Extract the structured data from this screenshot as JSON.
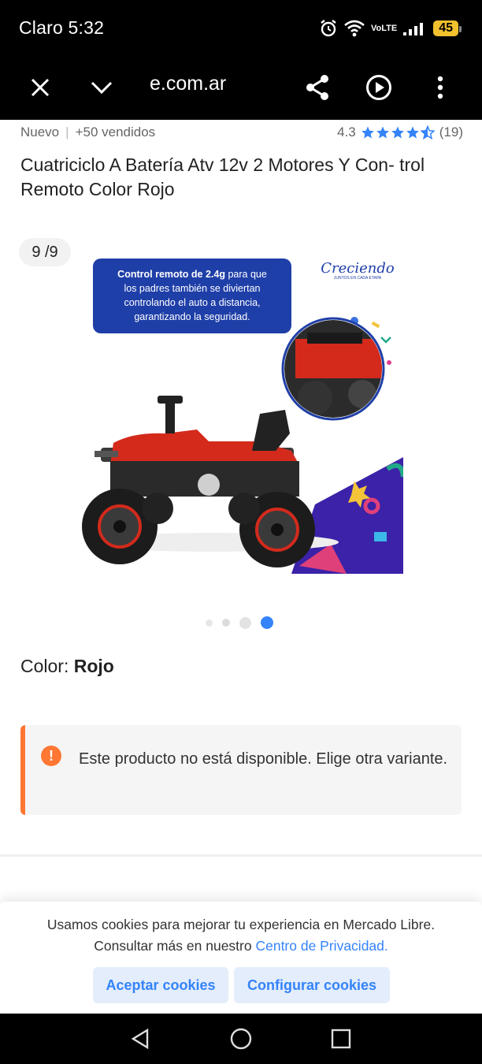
{
  "status_bar": {
    "carrier_time": "Claro 5:32",
    "network_top": "Vo",
    "network_bottom": "LTE",
    "battery": "45"
  },
  "browser": {
    "url": "e.com.ar",
    "icons": [
      "close-icon",
      "chevron-down-icon",
      "share-icon",
      "play-icon",
      "more-vert-icon"
    ]
  },
  "product": {
    "condition": "Nuevo",
    "separator": "|",
    "sold": "+50 vendidos",
    "rating_value": "4.3",
    "rating_count": "(19)",
    "rating_stars": 4.3,
    "title": "Cuatriciclo A Batería Atv 12v 2 Motores Y Con- trol Remoto Color Rojo"
  },
  "gallery": {
    "counter": "9 /9",
    "callout_bold": "Control remoto de 2.4g",
    "callout_rest": " para que los padres también se diviertan controlando el auto a distancia, garantizando la seguridad.",
    "brand": "Creciendo",
    "brand_tagline": "JUNTOS EN CADA ETAPA",
    "active_dot": 4,
    "dot_count": 4
  },
  "variant": {
    "label": "Color: ",
    "value": "Rojo"
  },
  "notice": {
    "message": "Este producto no está disponible. Elige otra variante."
  },
  "cookie_banner": {
    "text": "Usamos cookies para mejorar tu experiencia en Mercado Libre. Consultar más en nuestro ",
    "link": "Centro de Privacidad.",
    "accept_label": "Aceptar cookies",
    "configure_label": "Configurar cookies"
  },
  "colors": {
    "accent_blue": "#3483fa",
    "warning_orange": "#ff7733",
    "battery_yellow": "#f2c12e",
    "callout_blue": "#1f3fa8"
  }
}
